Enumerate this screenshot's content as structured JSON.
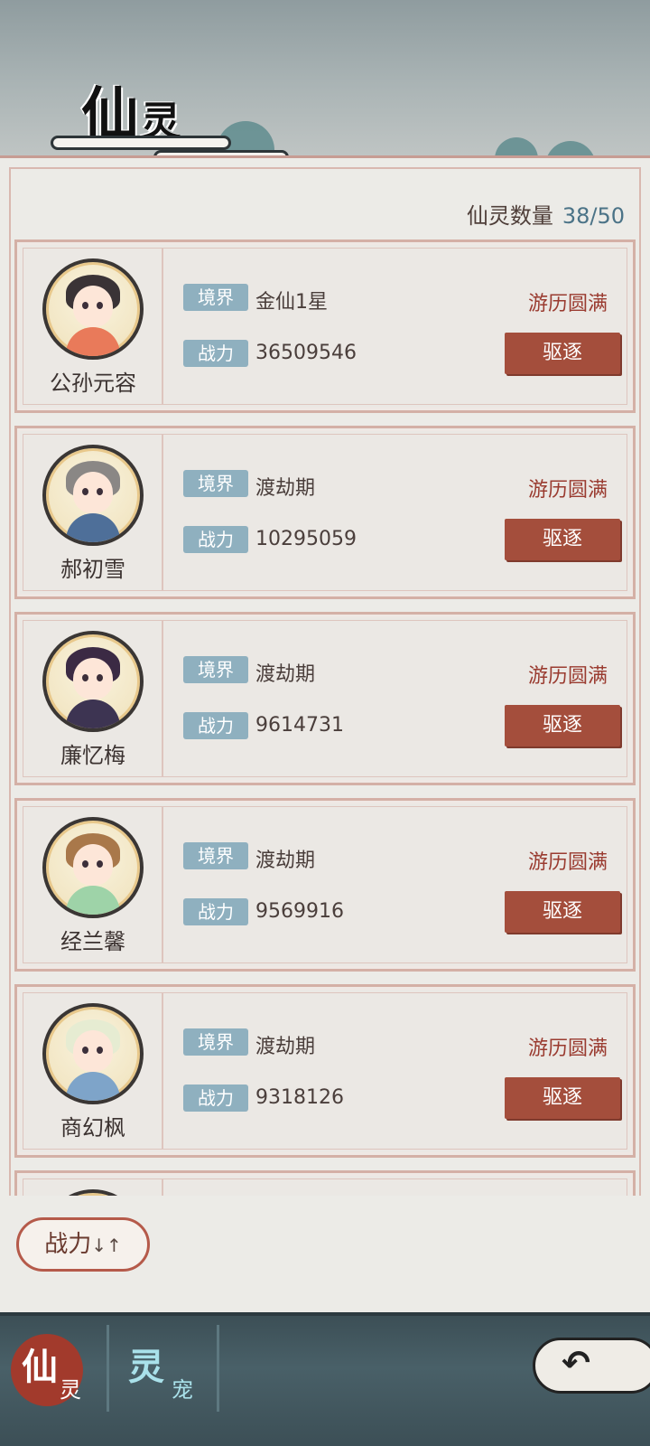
{
  "header": {
    "title_big": "仙",
    "title_small": "灵"
  },
  "summary": {
    "label": "仙灵数量",
    "value": "38/50"
  },
  "labels": {
    "realm_tag": "境界",
    "power_tag": "战力",
    "expel_button": "驱逐"
  },
  "spirits": [
    {
      "name": "公孙元容",
      "realm": "金仙1星",
      "power": "36509546",
      "status": "游历圆满"
    },
    {
      "name": "郝初雪",
      "realm": "渡劫期",
      "power": "10295059",
      "status": "游历圆满"
    },
    {
      "name": "廉忆梅",
      "realm": "渡劫期",
      "power": "9614731",
      "status": "游历圆满"
    },
    {
      "name": "经兰馨",
      "realm": "渡劫期",
      "power": "9569916",
      "status": "游历圆满"
    },
    {
      "name": "商幻枫",
      "realm": "渡劫期",
      "power": "9318126",
      "status": "游历圆满"
    }
  ],
  "sort": {
    "label": "战力",
    "icon": "sort-arrows-icon",
    "arrows": "↓↑"
  },
  "bottom_tabs": [
    {
      "big": "仙",
      "small": "灵",
      "active": true
    },
    {
      "big": "灵",
      "small": "宠",
      "active": false
    }
  ],
  "back": {
    "icon": "back-arrow-icon",
    "glyph": "↶"
  },
  "colors": {
    "accent_red": "#a44e3c",
    "tag_blue": "#8fb0bf",
    "count_blue": "#4b7387",
    "status_red": "#9a3b30"
  }
}
